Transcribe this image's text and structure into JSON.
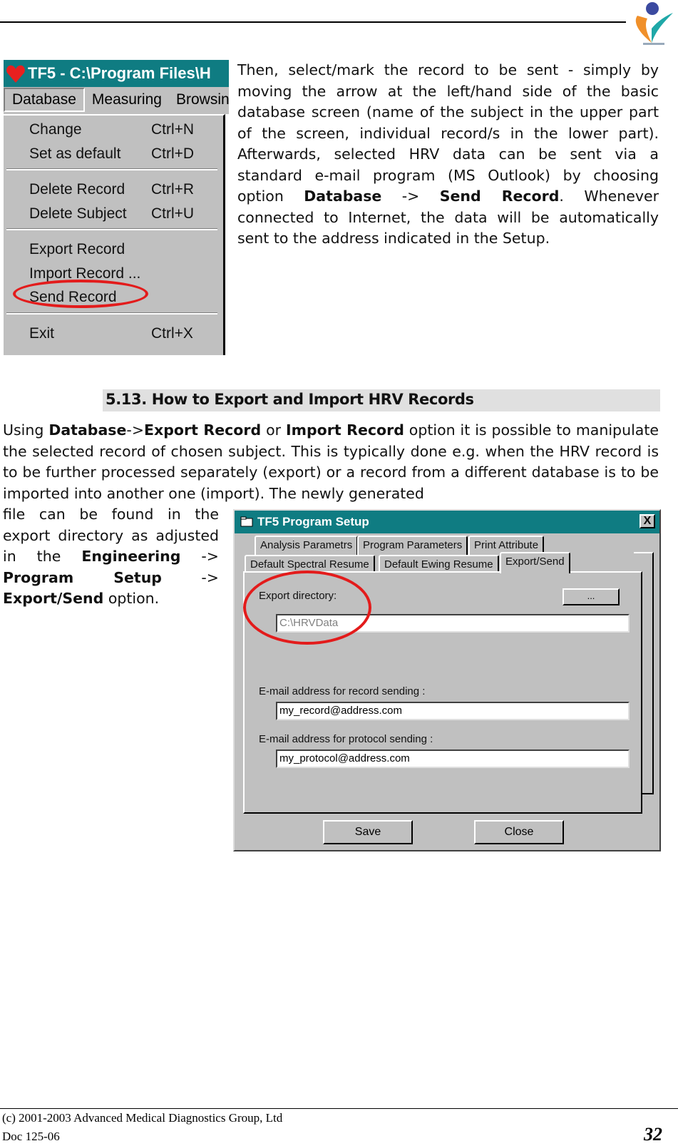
{
  "header": {
    "logo": "cardio-heart-logo"
  },
  "menu_screenshot": {
    "title": "TF5 - C:\\Program Files\\H",
    "menubar": [
      "Database",
      "Measuring",
      "Browsin"
    ],
    "items": [
      {
        "label": "Change",
        "shortcut": "Ctrl+N"
      },
      {
        "label": "Set as default",
        "shortcut": "Ctrl+D"
      },
      {
        "label": "Delete Record",
        "shortcut": "Ctrl+R"
      },
      {
        "label": "Delete Subject",
        "shortcut": "Ctrl+U"
      },
      {
        "label": "Export Record",
        "shortcut": ""
      },
      {
        "label": "Import Record ...",
        "shortcut": ""
      },
      {
        "label": "Send Record",
        "shortcut": ""
      },
      {
        "label": "Exit",
        "shortcut": "Ctrl+X"
      }
    ],
    "highlighted": "Send Record",
    "highlight_color": "#e31b1b"
  },
  "para1": {
    "t1": "Then, select/mark the record to be sent - simply by moving the arrow at the left/hand side of the basic database screen (name of the subject in the upper part of the screen, individual record/s in the lower part). Afterwards, selected HRV data can be sent via a standard e-mail program (MS Outlook) by choosing option ",
    "b1": "Database",
    "t2": " -> ",
    "b2": "Send Record",
    "t3": ". Whenever connected to Internet, the data will be automatically sent to the address indicated in the Setup."
  },
  "section": {
    "title": "5.13. How to Export and Import HRV Records"
  },
  "para2": {
    "t1": "Using ",
    "b1": "Database",
    "t2": "->",
    "b2": "Export Record",
    "t3": " or ",
    "b3": "Import Record",
    "t4": " option it is possible to manipulate the selected record of chosen subject. This is typically done e.g. when the HRV record is to be further processed separately (export) or a record from a different database is to be imported into another one (import). The newly generated"
  },
  "para3": {
    "t1": "file can be found in the export directory as adjusted in the ",
    "b1": "Engineering",
    "t2": " -> ",
    "b2": "Program Setup",
    "t3": " -> ",
    "b3": "Export/Send",
    "t4": " option."
  },
  "dialog": {
    "title": "TF5 Program Setup",
    "close": "X",
    "tabs_row1": [
      "Analysis Parametrs",
      "Program Parameters",
      "Print Attribute"
    ],
    "tabs_row2": [
      "Default Spectral Resume",
      "Default Ewing Resume",
      "Export/Send"
    ],
    "active_tab": "Export/Send",
    "export_dir_label": "Export directory:",
    "export_dir_value": "C:\\HRVData",
    "browse_label": "...",
    "record_email_label": "E-mail address for  record sending :",
    "record_email_value": "my_record@address.com",
    "protocol_email_label": "E-mail address for  protocol sending :",
    "protocol_email_value": "my_protocol@address.com",
    "save": "Save",
    "close_button": "Close"
  },
  "footer": {
    "copyright": "(c) 2001-2003 Advanced Medical Diagnostics Group, Ltd",
    "doc": "Doc 125-06",
    "page": "32"
  }
}
